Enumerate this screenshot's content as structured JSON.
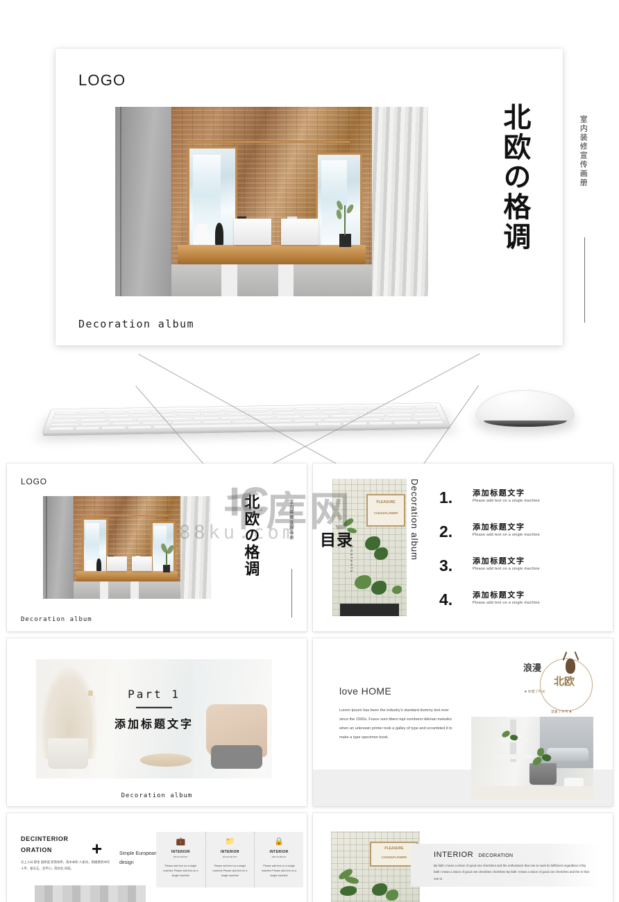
{
  "hero": {
    "logo": "LOGO",
    "vertical_title": "北欧の格调",
    "vertical_subtitle": "室内装修宣传画册",
    "footer": "Decoration   album"
  },
  "devices": {
    "keyboard_name": "keyboard-image",
    "mouse_name": "mouse-image"
  },
  "watermark": {
    "brand": "千库网",
    "prefix": "IC",
    "domain": "88ku.com"
  },
  "slides": {
    "cover": {
      "logo": "LOGO",
      "vertical_title": "北欧の格调",
      "vertical_subtitle": "室内装修宣传画册",
      "footer": "Decoration   album"
    },
    "contents": {
      "cn_title": "目录",
      "en_vertical": "Contents",
      "side_title": "Decoration   album",
      "items": [
        {
          "num": "1.",
          "heading": "添加标题文字",
          "sub": "Please add text on a single machine"
        },
        {
          "num": "2.",
          "heading": "添加标题文字",
          "sub": "Please add text on a single machine"
        },
        {
          "num": "3.",
          "heading": "添加标题文字",
          "sub": "Please add text on a single machine"
        },
        {
          "num": "4.",
          "heading": "添加标题文字",
          "sub": "Please add text on a single machine"
        }
      ]
    },
    "part1": {
      "en": "Part 1",
      "cn": "添加标题文字",
      "footer": "Decoration   album"
    },
    "love_home": {
      "title": "love HOME",
      "body": "Lorem Ipsum has been the industry's standard dummy text ever since the 1500s. Fusce som libero topi sombrero bikinan meksiko when an unknown printer took a galley of type and scrambled it to make a type specimen book.",
      "badge_cn_left": "浪漫",
      "badge_cn_right": "北欧",
      "badge_tag_left": "■ 你肥了时光",
      "badge_tag_right": "温暖了岁月 ■"
    },
    "dec_interior": {
      "heading": "DECINTERIOR\nORATION",
      "cn_body": "天上人间 郁金 留原留 黑南地带，南木本积 人家风，南模建筑中的十平，极东五，北平川，南风北 风成。",
      "plus": "+",
      "sub": "Simple  European indoor decoration design",
      "cells": [
        {
          "icon": "briefcase-icon",
          "glyph": "💼",
          "t1": "INTERIOR",
          "t2": "decoration",
          "p": "Please add text on a single machine Please add text on a single machine"
        },
        {
          "icon": "folder-icon",
          "glyph": "📁",
          "t1": "INTERIOR",
          "t2": "decoration",
          "p": "Please add text on a single machine Please add text on a single machine"
        },
        {
          "icon": "lock-icon",
          "glyph": "🔒",
          "t1": "INTERIOR",
          "t2": "decoration",
          "p": "Please add text on a single machine Please add text on a single machine"
        }
      ]
    },
    "interior_dec": {
      "heading": "INTERIOR",
      "heading_small": "DECORATION",
      "body": "By faith I mean a vision of good one cherishes and the enthusiasm that one to seek its fulfilment regardless of By faith I mean a vision of good one cherishes cherishes By faith I mean a vision of good one cherishes and the m that one to"
    }
  },
  "photo_signs": {
    "line1": "PLEASURE",
    "line2": "CAKE&FLOWER"
  },
  "colors": {
    "page_bg": "#ffffff",
    "slide_bg": "#ffffff",
    "text": "#1c1c1c",
    "muted": "#4a4a4a",
    "panel": "#f0f0f0",
    "accent_wood": "#c08b4e",
    "accent_gold": "#9a7b4e"
  }
}
